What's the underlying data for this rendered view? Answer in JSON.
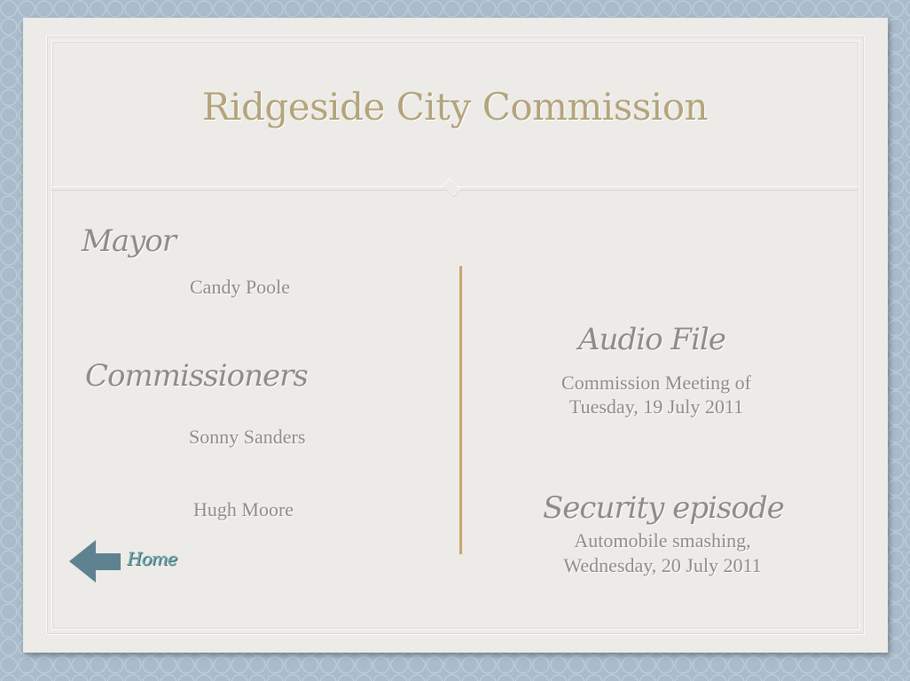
{
  "title": "Ridgeside City Commission",
  "mayor": {
    "heading": "Mayor",
    "name": "Candy Poole"
  },
  "commissioners": {
    "heading": "Commissioners",
    "names": [
      "Sonny Sanders",
      "Hugh Moore"
    ]
  },
  "audio": {
    "heading": "Audio File",
    "line1": "Commission Meeting of",
    "line2": "Tuesday, 19 July 2011"
  },
  "security": {
    "heading": "Security episode",
    "line1": "Automobile smashing,",
    "line2": "Wednesday, 20 July 2011"
  },
  "nav": {
    "home_label": "Home"
  },
  "colors": {
    "title": "#b4a47c",
    "divider": "#c9a56c",
    "arrow": "#5f8290",
    "home": "#6fa7b0",
    "background": "#a9bccb"
  }
}
